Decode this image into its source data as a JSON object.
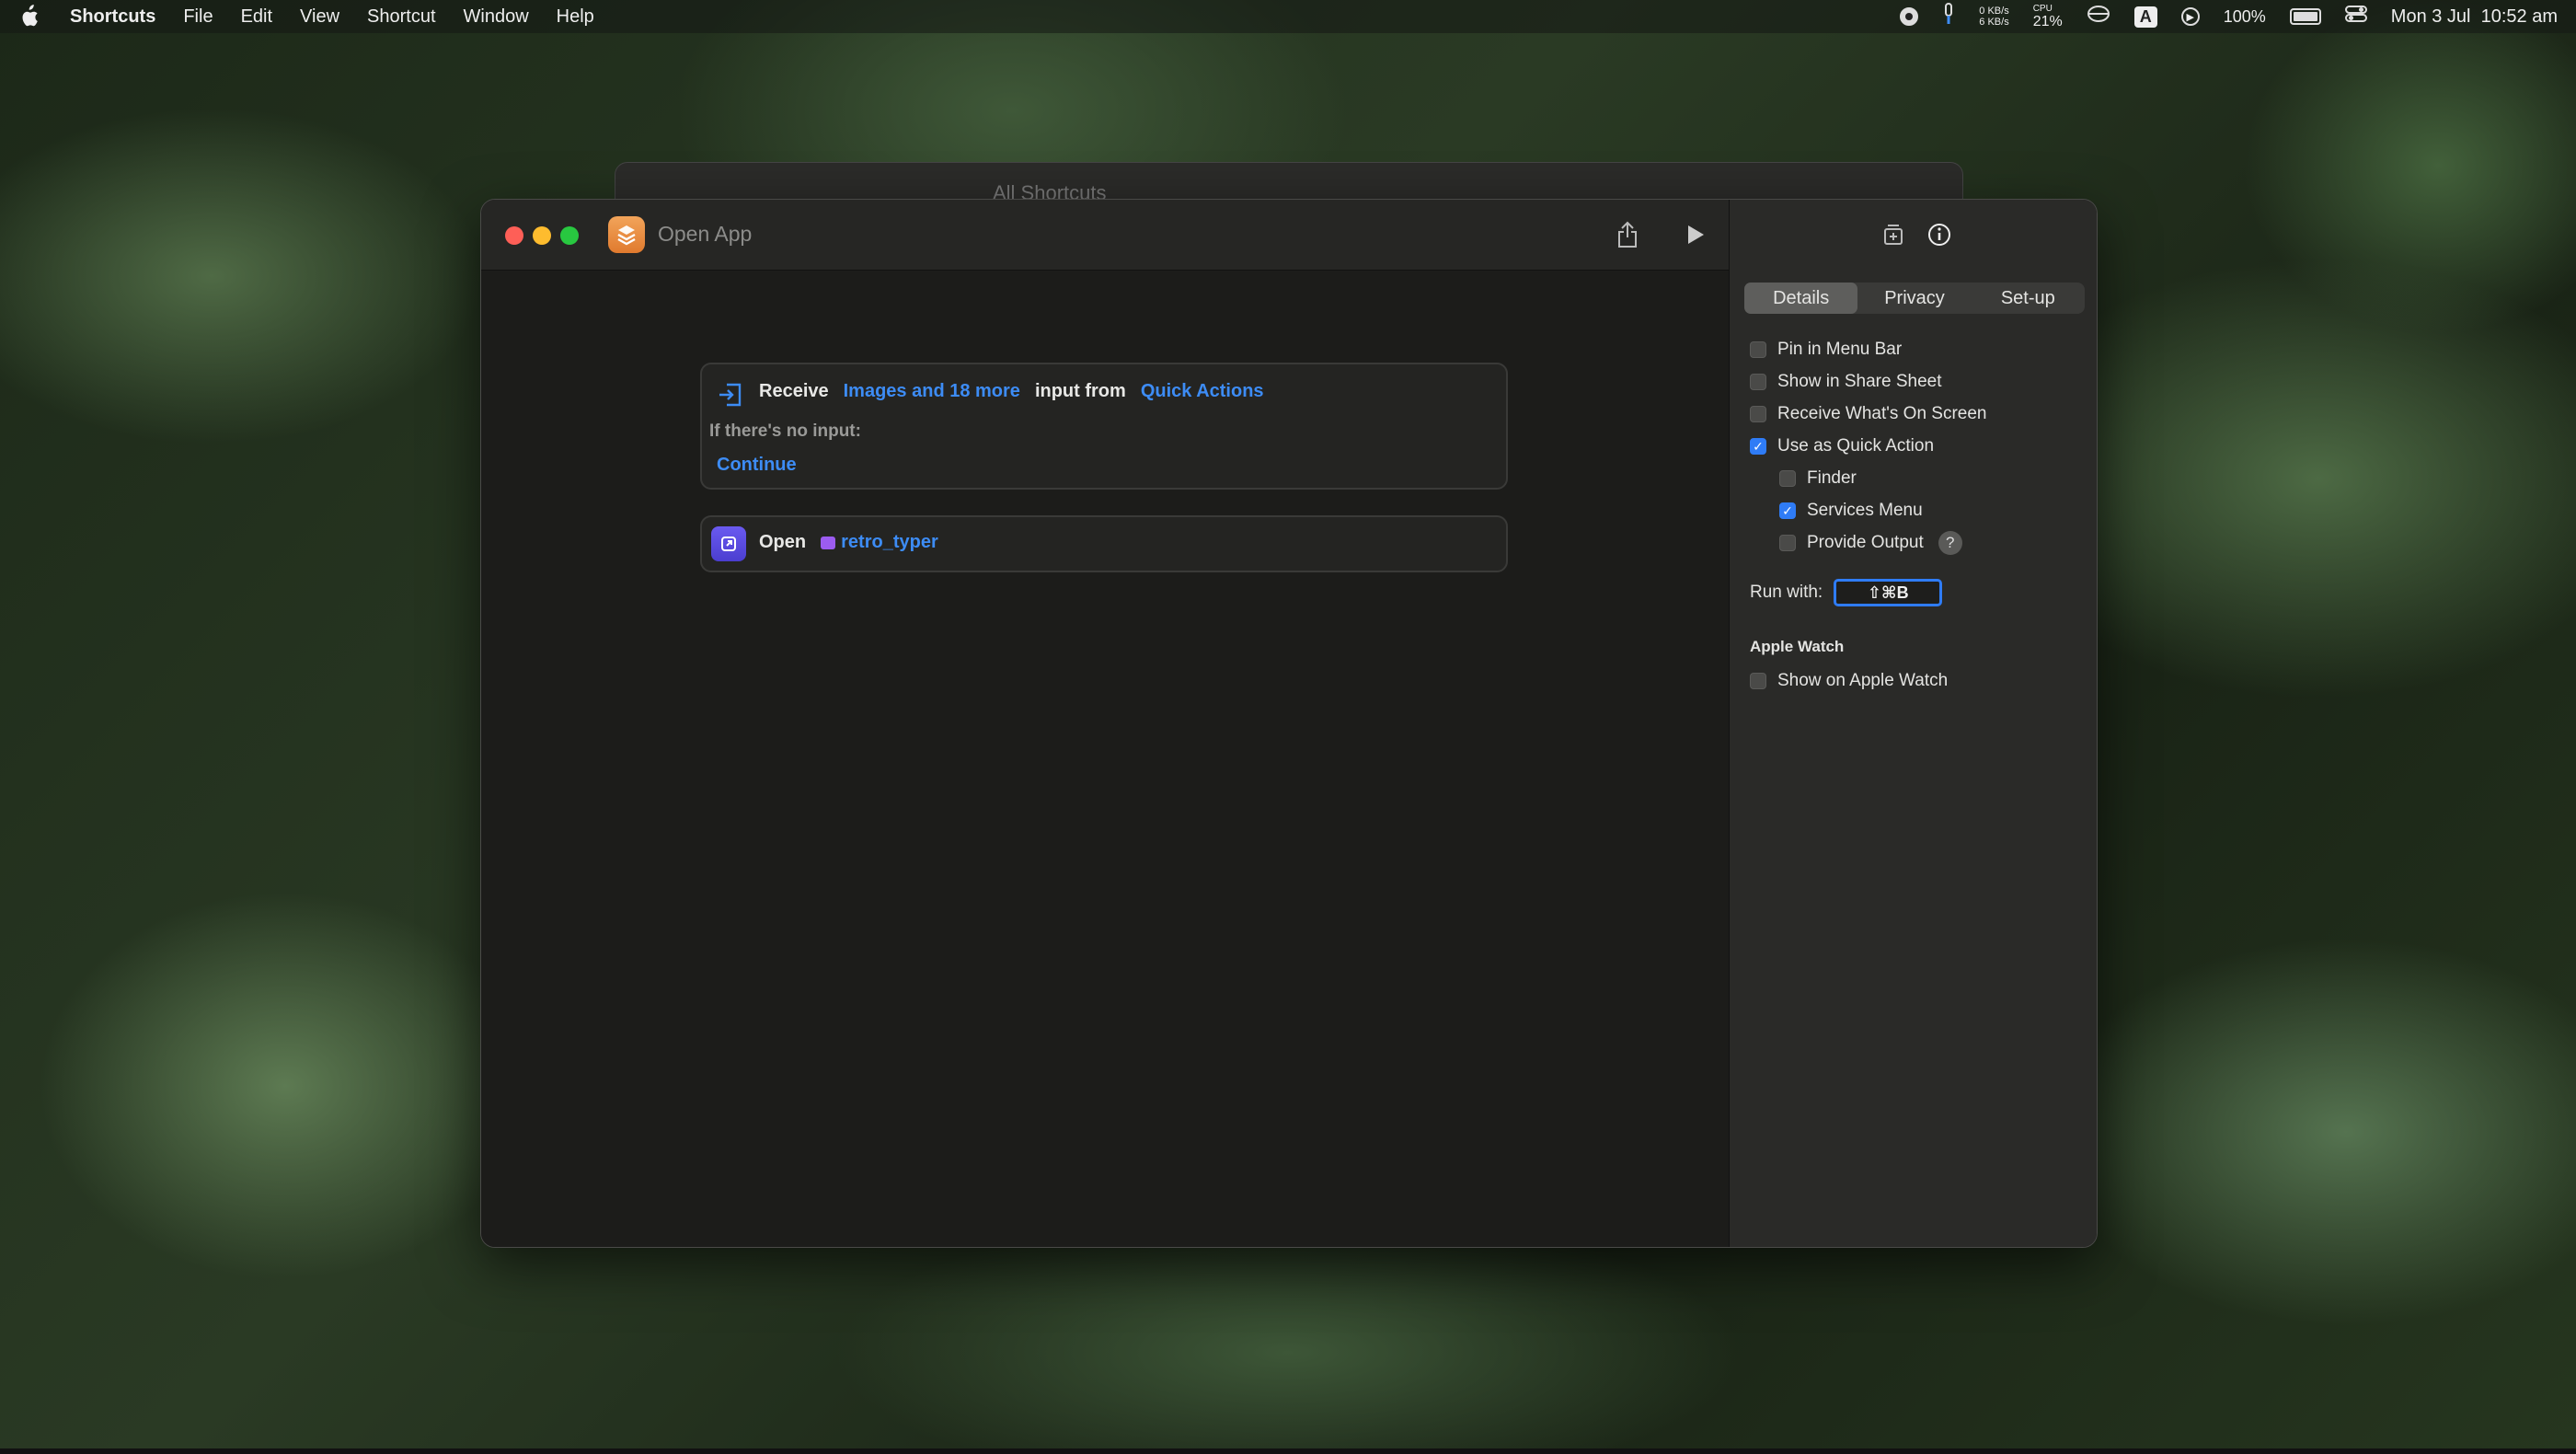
{
  "menubar": {
    "app": "Shortcuts",
    "items": [
      "File",
      "Edit",
      "View",
      "Shortcut",
      "Window",
      "Help"
    ],
    "net_up": "0 KB/s",
    "net_down": "6 KB/s",
    "cpu_label": "CPU",
    "cpu_value": "21%",
    "input_badge": "A",
    "battery": "100%",
    "datetime": "Mon 3 Jul  10:52 am"
  },
  "background_window": {
    "title": "All Shortcuts"
  },
  "window": {
    "title": "Open App"
  },
  "actions": {
    "receive": {
      "label": "Receive",
      "types_token": "Images and 18 more",
      "middle": "input from",
      "source_token": "Quick Actions",
      "no_input_label": "If there's no input:",
      "no_input_action": "Continue"
    },
    "open": {
      "label": "Open",
      "app_token": "retro_typer"
    }
  },
  "inspector": {
    "tabs": [
      "Details",
      "Privacy",
      "Set-up"
    ],
    "active_tab": "Details",
    "options": {
      "pin_menu_bar": {
        "label": "Pin in Menu Bar",
        "checked": false
      },
      "share_sheet": {
        "label": "Show in Share Sheet",
        "checked": false
      },
      "on_screen": {
        "label": "Receive What's On Screen",
        "checked": false
      },
      "quick_action": {
        "label": "Use as Quick Action",
        "checked": true
      },
      "finder": {
        "label": "Finder",
        "checked": false
      },
      "services": {
        "label": "Services Menu",
        "checked": true
      },
      "provide_output": {
        "label": "Provide Output",
        "checked": false
      }
    },
    "help_glyph": "?",
    "run_with_label": "Run with:",
    "run_with_value": "⇧⌘B",
    "apple_watch_header": "Apple Watch",
    "apple_watch": {
      "label": "Show on Apple Watch",
      "checked": false
    }
  },
  "colors": {
    "accent": "#2f7cf6",
    "token": "#3d8cf5",
    "app_icon": "#e8893a"
  }
}
